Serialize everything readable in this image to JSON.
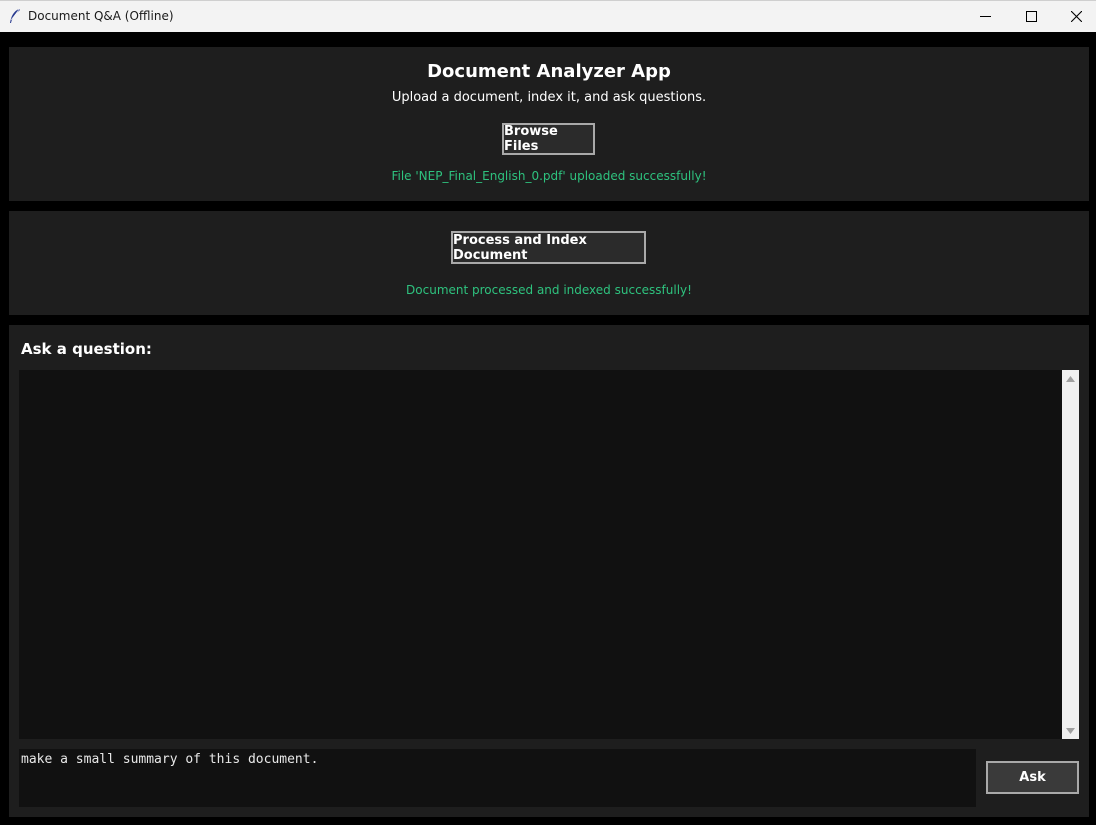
{
  "window": {
    "title": "Document Q&A (Offline)"
  },
  "upload": {
    "heading": "Document Analyzer App",
    "subtitle": "Upload a document, index it, and ask questions.",
    "browse_label": "Browse Files",
    "status": "File 'NEP_Final_English_0.pdf' uploaded successfully!"
  },
  "process": {
    "button_label": "Process and Index Document",
    "status": "Document processed and indexed successfully!"
  },
  "qa": {
    "label": "Ask a question:",
    "answer": "",
    "question_value": "make a small summary of this document.",
    "ask_label": "Ask"
  },
  "colors": {
    "background": "#000000",
    "panel": "#1e1e1e",
    "text_area": "#111111",
    "success": "#2ec27e"
  }
}
